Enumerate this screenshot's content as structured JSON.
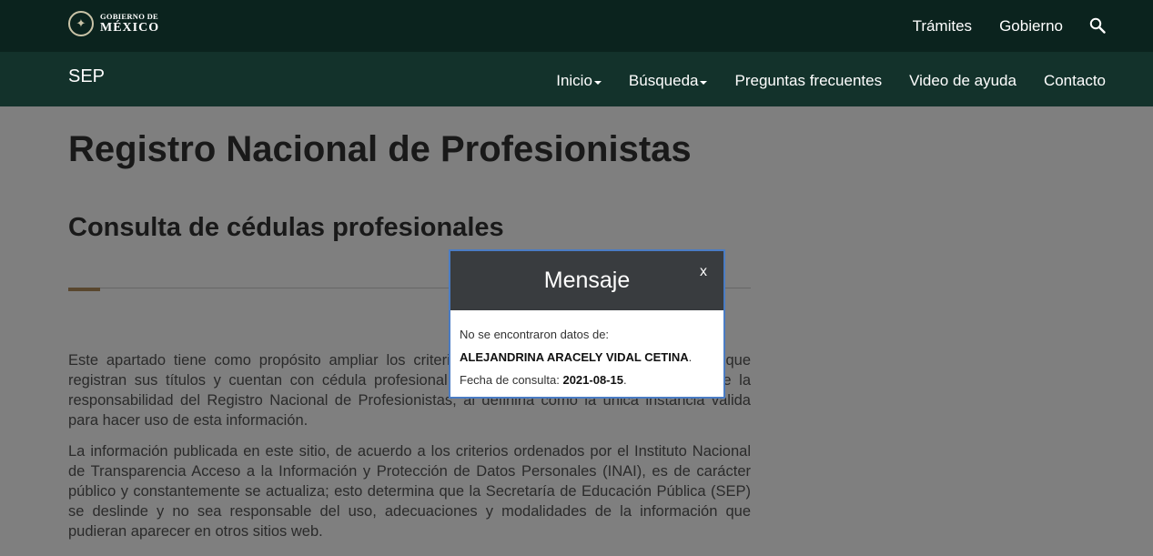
{
  "topbar": {
    "logo": {
      "line1": "GOBIERNO DE",
      "line2": "MÉXICO"
    },
    "nav": [
      {
        "label": "Trámites"
      },
      {
        "label": "Gobierno"
      }
    ],
    "search_icon": "search-icon"
  },
  "subbar": {
    "brand": "SEP",
    "nav": [
      {
        "label": "Inicio",
        "dropdown": true
      },
      {
        "label": "Búsqueda",
        "dropdown": true
      },
      {
        "label": "Preguntas frecuentes"
      },
      {
        "label": "Video de ayuda"
      },
      {
        "label": "Contacto"
      }
    ]
  },
  "page": {
    "title": "Registro Nacional de Profesionistas",
    "subtitle": "Consulta de cédulas profesionales",
    "paragraph1": "Este apartado tiene como propósito ampliar los criterios de búsqueda de los profesionistas que registran sus títulos y cuentan con cédula profesional, sin que ello represente deslindarse de la responsabilidad del Registro Nacional de Profesionistas, al definirla como la única instancia válida para hacer uso de esta información.",
    "paragraph2": "La información publicada en este sitio, de acuerdo a los criterios ordenados por el Instituto Nacional de Transparencia  Acceso a la Información y Protección de Datos Personales (INAI), es de carácter público y constantemente se actualiza; esto determina que la Secretaría de Educación Pública (SEP) se deslinde y no sea responsable del uso, adecuaciones y modalidades de la información que pudieran aparecer en otros sitios web."
  },
  "modal": {
    "title": "Mensaje",
    "close_label": "x",
    "line1": "No se encontraron datos de:",
    "name": "ALEJANDRINA ARACELY VIDAL CETINA",
    "name_suffix": ".",
    "date_label": "Fecha de consulta: ",
    "date_value": "2021-08-15",
    "date_suffix": "."
  },
  "colors": {
    "topbar": "#0b231e",
    "subbar": "#13322b",
    "accent": "#b38e5d",
    "modal_header": "#393c3f",
    "modal_border": "#4a7cc4"
  }
}
